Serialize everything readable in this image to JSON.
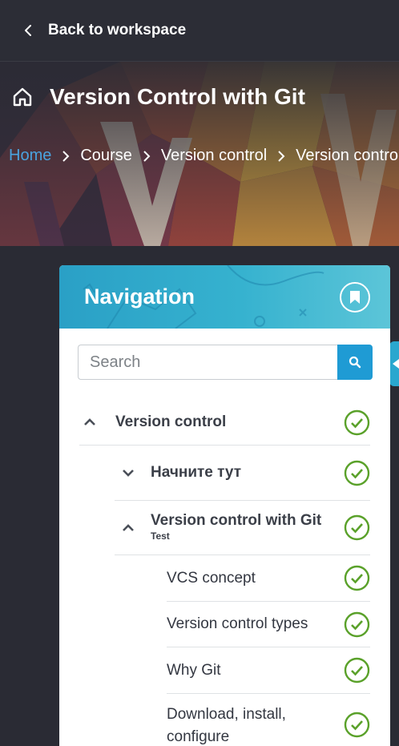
{
  "topbar": {
    "back_label": "Back to workspace",
    "icon": "chevron-left-icon"
  },
  "hero": {
    "course_title": "Version Control with Git",
    "breadcrumb": [
      "Home",
      "Course",
      "Version control",
      "Version control"
    ]
  },
  "navigation": {
    "title": "Navigation",
    "search": {
      "placeholder": "Search",
      "value": ""
    },
    "accent_color": "#2aa7cf",
    "check_color": "#5aa12a",
    "items": [
      {
        "label": "Version control",
        "subtitle": "",
        "expanded": true,
        "completed": true
      },
      {
        "label": "Начните тут",
        "subtitle": "",
        "expanded": false,
        "completed": true
      },
      {
        "label": "Version control with Git",
        "subtitle": "Test",
        "expanded": true,
        "completed": true
      },
      {
        "label": "VCS concept",
        "subtitle": "",
        "completed": true
      },
      {
        "label": "Version control types",
        "subtitle": "",
        "completed": true
      },
      {
        "label": "Why Git",
        "subtitle": "",
        "completed": true
      },
      {
        "label": "Download, install, configure",
        "subtitle": "",
        "completed": true
      }
    ]
  }
}
